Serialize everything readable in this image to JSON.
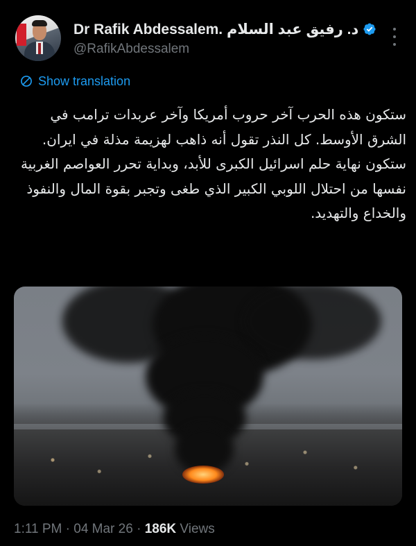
{
  "author": {
    "display_name": "Dr Rafik Abdessalem. د. رفيق عبد السلام",
    "handle": "@RafikAbdessalem",
    "verified": true,
    "avatar_icon": "profile-photo",
    "verified_icon": "verified-badge-icon",
    "more_icon": "more-options-icon"
  },
  "translation": {
    "label": "Show translation",
    "icon": "globe-icon"
  },
  "tweet": {
    "paragraphs": [
      "ستكون هذه الحرب آخر حروب أمريكا وآخر عربدات ترامب في الشرق الأوسط. كل النذر تقول أنه ذاهب لهزيمة مذلة في ايران.",
      "ستكون نهاية حلم اسرائيل الكبرى للأبد، وبداية تحرر العواصم الغربية نفسها من احتلال اللوبي الكبير الذي طغى وتجبر بقوة المال والنفوذ والخداع والتهديد."
    ]
  },
  "meta": {
    "time": "1:11 PM",
    "separator": "·",
    "date": "04 Mar 26",
    "views_count": "186K",
    "views_label": "Views"
  },
  "colors": {
    "background": "#000000",
    "text": "#e7e9ea",
    "secondary": "#71767b",
    "accent": "#1d9bf0"
  }
}
